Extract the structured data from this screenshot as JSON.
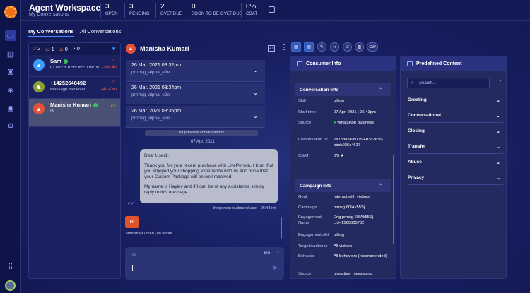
{
  "header": {
    "title": "Agent Workspace",
    "subtitle": "My Conversations",
    "kpis": [
      {
        "value": "3",
        "label": "OPEN"
      },
      {
        "value": "3",
        "label": "PENDING"
      },
      {
        "value": "2",
        "label": "OVERDUE"
      },
      {
        "value": "0",
        "label": "SOON TO BE OVERDUE"
      },
      {
        "value": "0%",
        "label": "CSAT"
      }
    ]
  },
  "tabs": [
    {
      "label": "My Conversations"
    },
    {
      "label": "All Conversations"
    }
  ],
  "filters": {
    "overdue": "2",
    "waiting": "1",
    "escalated": "0",
    "paused": "0"
  },
  "conversations": [
    {
      "name": "Sam",
      "message": "COWER BEFORE THE M...",
      "time": "-30d 4h",
      "channel": "whatsapp"
    },
    {
      "name": "+14252648492",
      "message": "Message Received",
      "time": "-4h 43m",
      "channel": ""
    },
    {
      "name": "Manisha Kumari",
      "message": "Hi",
      "time": "",
      "channel": "whatsapp"
    }
  ],
  "chat": {
    "name": "Manisha Kumari",
    "previous": [
      {
        "date": "26 Mar. 2021 03:32pm",
        "skill": "prrmsg_alpha_e2e"
      },
      {
        "date": "26 Mar. 2021 03:34pm",
        "skill": "prrmsg_alpha_e2e"
      },
      {
        "date": "26 Mar. 2021 03:35pm",
        "skill": "prrmsg_alpha_e2e"
      }
    ],
    "previous_count": "49 previous conversations",
    "date_separator": "07 Apr. 2021",
    "agent_message": {
      "paragraphs": [
        "Dear User1,",
        "Thank you for your recent purchase with LivePerson. I trust that you enjoyed your shopping experience with us and hope that your Custom Package will be well received.",
        "My name is Hayley and if I can be of any assistance simply reply to this message."
      ],
      "meta": "liveperson-outbound-user  |  06:43pm"
    },
    "customer_message": {
      "text": "Hi",
      "meta": "Manisha Kumari  |  06:43pm"
    },
    "composer": {
      "counter": "8m"
    },
    "toolbar": [
      "",
      "",
      "",
      "",
      "",
      "",
      "CW"
    ]
  },
  "consumer_info": {
    "title": "Consumer Info",
    "conversation_info": {
      "title": "Conversation Info",
      "rows": [
        {
          "key": "Skill",
          "value": "billing"
        },
        {
          "key": "Start time",
          "value": "07 Apr. 2021 | 06:43pm"
        },
        {
          "key": "Source",
          "value": "WhatsApp Business"
        },
        {
          "key": "Conversation ID",
          "value": "2e7bda3e-b005-4d3c-9f36-bbcb926c4617"
        },
        {
          "key": "CSAT",
          "value": "0/5 ★"
        }
      ]
    },
    "campaign_info": {
      "title": "Campaign Info",
      "rows": [
        {
          "key": "Goal",
          "value": "Interact with visitors"
        },
        {
          "key": "Campaign",
          "value": "prmsg 60IAk55Sj"
        },
        {
          "key": "Engagement Name",
          "value": "Eng prmsg 60IAk55Sj -cId=1560805732"
        },
        {
          "key": "Engagement skill",
          "value": "billing"
        },
        {
          "key": "Target Audience",
          "value": "All visitors"
        },
        {
          "key": "Behavior",
          "value": "All behaviors (recommended)"
        },
        {
          "key": "Source",
          "value": "proactive_messaging"
        }
      ]
    }
  },
  "predefined": {
    "title": "Predefined Content",
    "search_placeholder": "Search...",
    "categories": [
      "Greeting",
      "Conversational",
      "Closing",
      "Transfer",
      "Abuse",
      "Privacy"
    ]
  },
  "colors": {
    "accent": "#4a8bff",
    "alert": "#f05a5a",
    "customer_bubble": "#e0532c",
    "whatsapp": "#35c35a"
  }
}
